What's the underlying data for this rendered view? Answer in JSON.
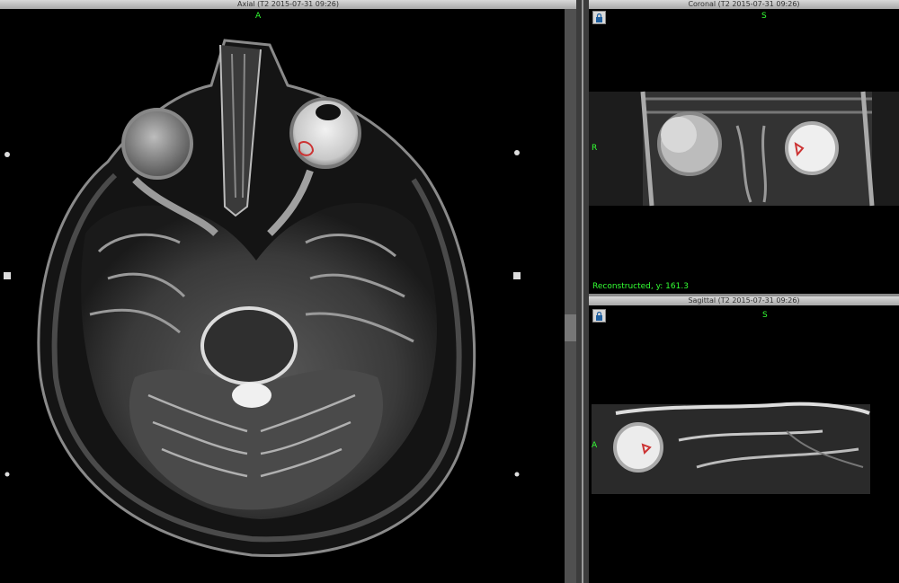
{
  "axial": {
    "title": "Axial (T2 2015-07-31 09:26)",
    "orient_top": "A"
  },
  "coronal": {
    "title": "Coronal (T2 2015-07-31 09:26)",
    "orient_top": "S",
    "orient_left": "R",
    "footer": "Reconstructed, y: 161.3"
  },
  "sagittal": {
    "title": "Sagittal (T2 2015-07-31 09:26)",
    "orient_top": "S",
    "orient_left": "A"
  },
  "icons": {
    "lock": "lock-icon"
  },
  "colors": {
    "overlay_text": "#33ff33",
    "roi_outline": "#cc3333"
  }
}
